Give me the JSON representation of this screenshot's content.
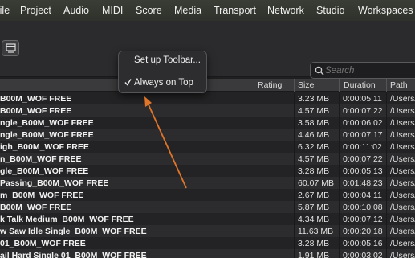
{
  "menubar": {
    "items": [
      "File",
      "Project",
      "Audio",
      "MIDI",
      "Score",
      "Media",
      "Transport",
      "Network",
      "Studio",
      "Workspaces"
    ]
  },
  "search": {
    "placeholder": "Search"
  },
  "popup": {
    "items": [
      {
        "label": "Set up Toolbar...",
        "checked": false
      },
      {
        "label": "Always on Top",
        "checked": true
      }
    ]
  },
  "table": {
    "columns": {
      "rating": "Rating",
      "size": "Size",
      "duration": "Duration",
      "path": "Path"
    },
    "rows": [
      {
        "name": "B00M_WOF FREE",
        "size": "3.23 MB",
        "duration": "0:00:05:11",
        "path": "/Users/m"
      },
      {
        "name": "B00M_WOF FREE",
        "size": "4.57 MB",
        "duration": "0:00:07:22",
        "path": "/Users/m"
      },
      {
        "name": "ngle_B00M_WOF FREE",
        "size": "3.58 MB",
        "duration": "0:00:06:02",
        "path": "/Users/m"
      },
      {
        "name": "ngle_B00M_WOF FREE",
        "size": "4.46 MB",
        "duration": "0:00:07:17",
        "path": "/Users/m"
      },
      {
        "name": "igh_B00M_WOF FREE",
        "size": "6.32 MB",
        "duration": "0:00:11:02",
        "path": "/Users/m"
      },
      {
        "name": "n_B00M_WOF FREE",
        "size": "4.57 MB",
        "duration": "0:00:07:22",
        "path": "/Users/m"
      },
      {
        "name": "gle_B00M_WOF FREE",
        "size": "3.28 MB",
        "duration": "0:00:05:13",
        "path": "/Users/m"
      },
      {
        "name": "Passing_B00M_WOF FREE",
        "size": "60.07 MB",
        "duration": "0:01:48:23",
        "path": "/Users/m"
      },
      {
        "name": "m_B00M_WOF FREE",
        "size": "2.67 MB",
        "duration": "0:00:04:11",
        "path": "/Users/m"
      },
      {
        "name": "B00M_WOF FREE",
        "size": "5.87 MB",
        "duration": "0:00:10:08",
        "path": "/Users/m"
      },
      {
        "name": "k Talk Medium_B00M_WOF FREE",
        "size": "4.34 MB",
        "duration": "0:00:07:12",
        "path": "/Users/m"
      },
      {
        "name": "w Saw Idle Single_B00M_WOF FREE",
        "size": "11.63 MB",
        "duration": "0:00:20:18",
        "path": "/Users/m"
      },
      {
        "name": "01_B00M_WOF FREE",
        "size": "3.28 MB",
        "duration": "0:00:05:16",
        "path": "/Users/m"
      },
      {
        "name": "ail Hard Single 01_B00M_WOF FREE",
        "size": "1.91 MB",
        "duration": "0:00:03:02",
        "path": "/Users/m"
      }
    ]
  },
  "colors": {
    "arrow": "#e0752a",
    "menubar": "#33362f",
    "accent": "#ffffff"
  },
  "icons": {
    "toolbar_button": "window-icon",
    "search": "magnifier-icon",
    "check": "checkmark-icon"
  }
}
